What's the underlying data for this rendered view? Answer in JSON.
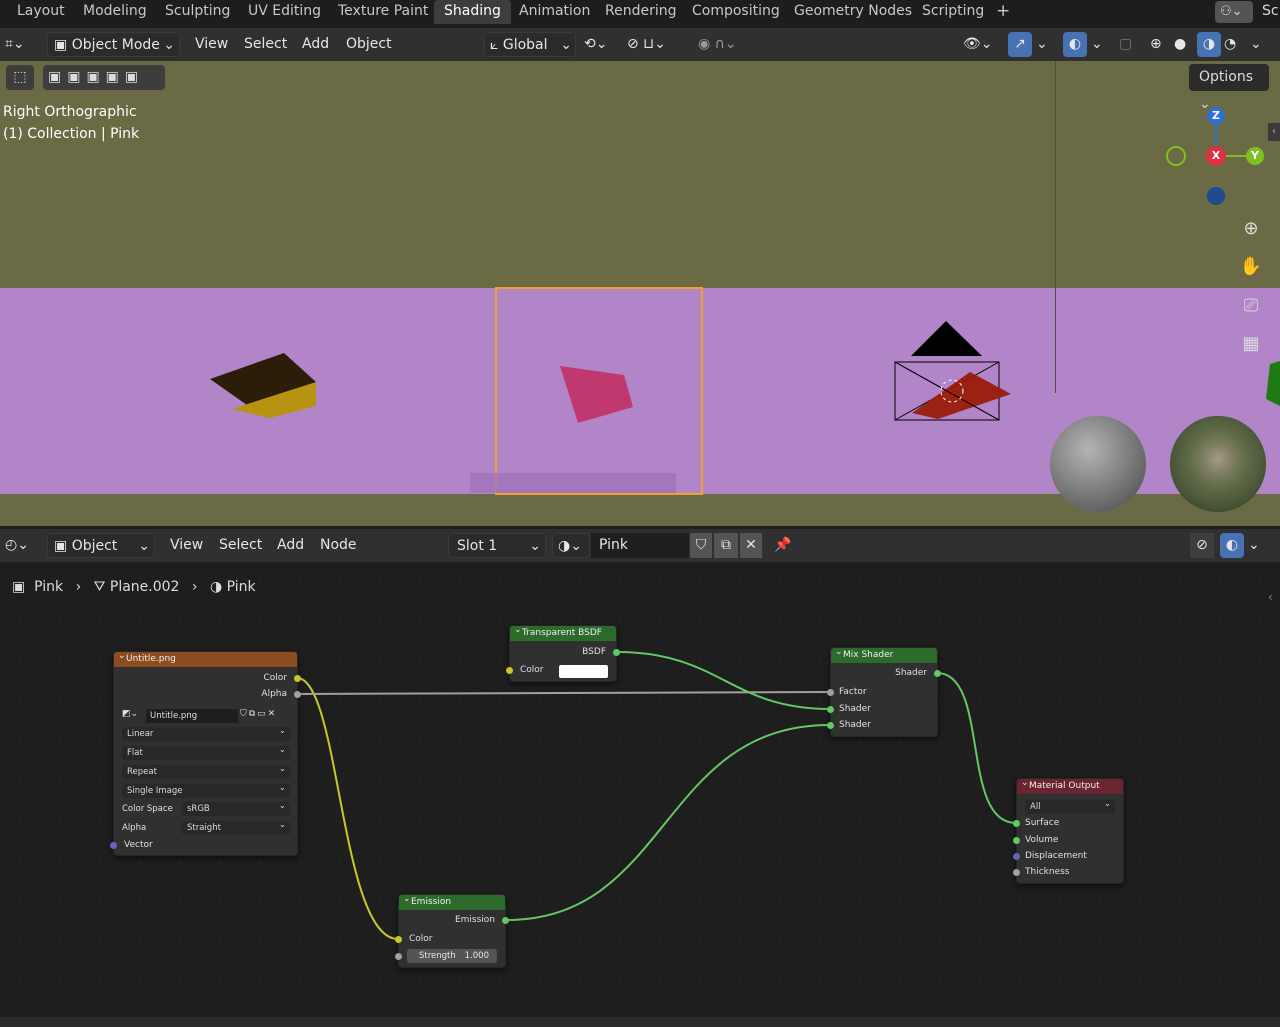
{
  "workspace_tabs": [
    "Layout",
    "Modeling",
    "Sculpting",
    "UV Editing",
    "Texture Paint",
    "Shading",
    "Animation",
    "Rendering",
    "Compositing",
    "Geometry Nodes",
    "Scripting"
  ],
  "active_tab": "Shading",
  "scene_truncated": "Sc",
  "viewport": {
    "mode": "Object Mode",
    "menus": [
      "View",
      "Select",
      "Add",
      "Object"
    ],
    "orientation": "Global",
    "options_label": "Options",
    "view_name": "Right Orthographic",
    "collection_info": "(1) Collection | Pink",
    "gizmo": {
      "z": "Z",
      "x": "X",
      "y": "Y"
    }
  },
  "node_editor": {
    "mode": "Object",
    "menus": [
      "View",
      "Select",
      "Add",
      "Node"
    ],
    "slot": "Slot 1",
    "material": "Pink",
    "breadcrumb": [
      "Pink",
      "Plane.002",
      "Pink"
    ],
    "nodes": {
      "image": {
        "title": "Untitle.png",
        "out_color": "Color",
        "out_alpha": "Alpha",
        "image_name": "Untitle.png",
        "interpolation": "Linear",
        "projection": "Flat",
        "extension": "Repeat",
        "source": "Single Image",
        "color_space_label": "Color Space",
        "color_space": "sRGB",
        "alpha_label": "Alpha",
        "alpha_mode": "Straight",
        "in_vector": "Vector"
      },
      "transparent": {
        "title": "Transparent BSDF",
        "out": "BSDF",
        "in_color": "Color"
      },
      "mix": {
        "title": "Mix Shader",
        "out": "Shader",
        "in_factor": "Factor",
        "in_shader1": "Shader",
        "in_shader2": "Shader"
      },
      "emission": {
        "title": "Emission",
        "out": "Emission",
        "in_color": "Color",
        "strength_label": "Strength",
        "strength_value": "1.000"
      },
      "output": {
        "title": "Material Output",
        "target": "All",
        "in_surface": "Surface",
        "in_volume": "Volume",
        "in_displacement": "Displacement",
        "in_thickness": "Thickness"
      }
    }
  },
  "colors": {
    "header_bg": "#303030",
    "accent_blue": "#4772b3",
    "viewport_bg": "#6a6a45",
    "band": "#b285c9",
    "image_node_header": "#8b4d1f",
    "shader_node_header": "#2c6b2c",
    "output_node_header": "#6a2530",
    "socket_yellow": "#c7c729",
    "socket_green": "#63c763",
    "socket_gray": "#a1a1a1",
    "socket_violet": "#6363c7"
  }
}
